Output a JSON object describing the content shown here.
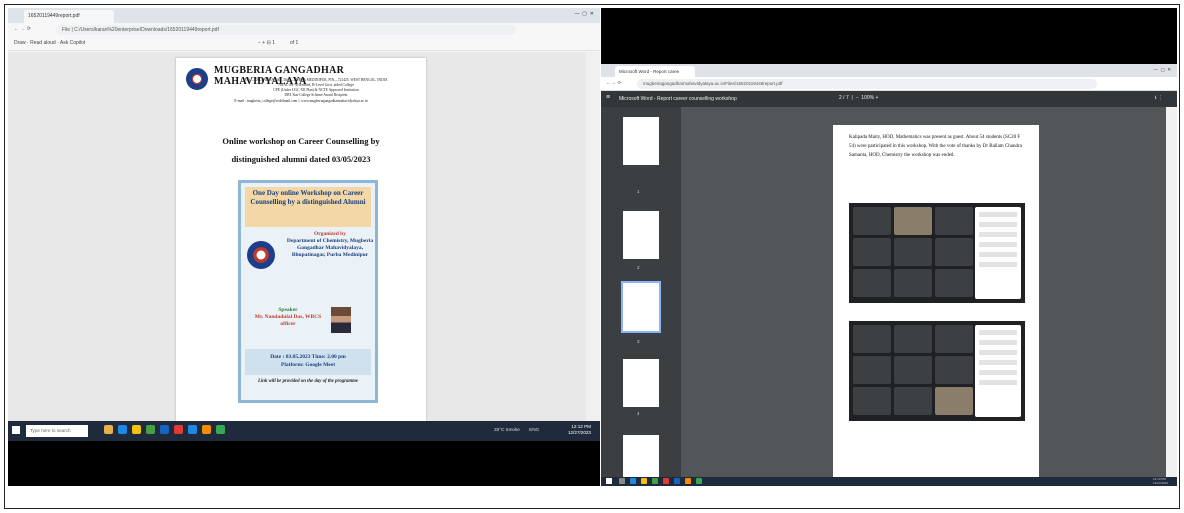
{
  "shot1": {
    "tab_title": "16520119449report.pdf",
    "address": "File | C:/Users/karan%20enterprise/Downloads/16520119449report.pdf",
    "toolbar": "Draw  ·  Read aloud  ·  Ask Copilot",
    "page_indicator": "of 1",
    "doc": {
      "college_name": "MUGBERIA GANGADHAR MAHAVIDYALAYA",
      "address_lines": [
        "P.O.—BHUPATINAGAR, Dist.—PURBA MEDINIPUR, PIN—721425, WEST BENGAL, INDIA",
        "NAAC Re-Accredited, B-Level Govt. aided College",
        "CPE (Under UGC XII Plan) & NCTE Approved Institution",
        "DBT Star College Scheme Award Recipient",
        "E-mail : mugberia_college@rediffmail.com // www.mugberiagangadharmahavidyalaya.ac.in"
      ],
      "heading_line1": "Online workshop on Career Counselling by",
      "heading_line2": "distinguished alumni dated 03/05/2023",
      "poster": {
        "title": "One Day online Workshop on Career Counselling by a distinguished Alumni",
        "org_label": "Organized by",
        "org_body": "Department of Chemistry, Mugberia Gangadhar Mahavidyalaya, Bhupatinagar, Purba Medinipur",
        "speaker_label": "Speaker",
        "speaker_name": "Mr. Nandadulal Das, WBCS officer",
        "date_time": "Date : 03.05.2023   Time: 2.00 pm",
        "platform": "Platform: Google Meet",
        "link_note": "Link will be provided on the day of the programme"
      }
    },
    "taskbar": {
      "search_placeholder": "Type here to search",
      "weather": "28°C Smoke",
      "lang": "ENG",
      "time": "12:12 PM",
      "date": "12/27/2023"
    }
  },
  "shot2": {
    "tab_title": "Microsoft Word - Report caree",
    "address": "mugberiagangadharmahavidyalaya.ac.in/Files/16520119449report.pdf",
    "pdf_title": "Microsoft Word - Report career counselling workshop",
    "page_box": "2 / 7",
    "zoom": "100%",
    "paragraph": "Kalipada Maity, HOD, Mathematics was present as guest. About 54 students (SC20 F 54) were participated in this workshop. With the vote of thanks by Dr Ballam Chandra Samanta, HOD, Chemistry the workshop was ended.",
    "thumb_numbers": [
      "1",
      "2",
      "3",
      "4"
    ],
    "clock": "12:13 PM 12/27/2023"
  }
}
